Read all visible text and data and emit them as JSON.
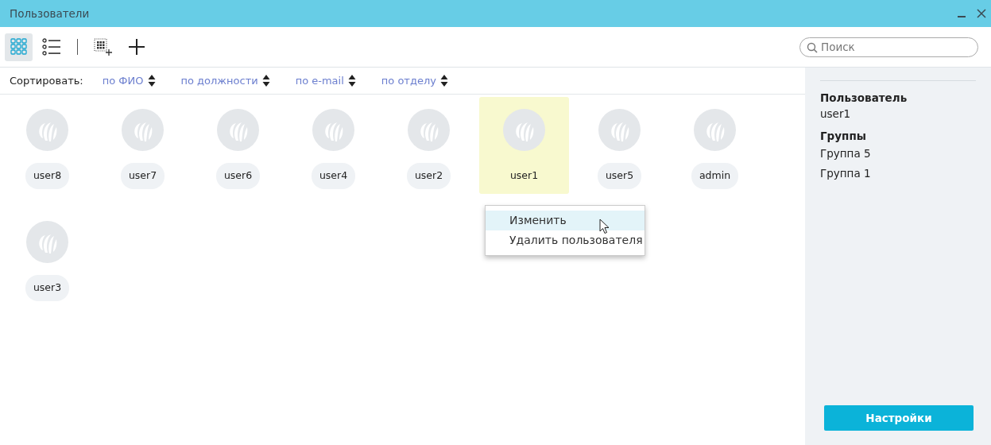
{
  "window": {
    "title": "Пользователи"
  },
  "toolbar": [
    {
      "kind": "grid-view",
      "selected": true
    },
    {
      "kind": "list-view",
      "selected": false
    },
    {
      "kind": "select-all"
    },
    {
      "kind": "add"
    }
  ],
  "search": {
    "placeholder": "Поиск"
  },
  "sort": {
    "label": "Сортировать:",
    "options": [
      {
        "label": "по ФИО"
      },
      {
        "label": "по должности"
      },
      {
        "label": "по e-mail"
      },
      {
        "label": "по отделу"
      }
    ]
  },
  "users": [
    {
      "name": "user8",
      "selected": false
    },
    {
      "name": "user7",
      "selected": false
    },
    {
      "name": "user6",
      "selected": false
    },
    {
      "name": "user4",
      "selected": false
    },
    {
      "name": "user2",
      "selected": false
    },
    {
      "name": "user1",
      "selected": true
    },
    {
      "name": "user5",
      "selected": false
    },
    {
      "name": "admin",
      "selected": false
    },
    {
      "name": "user3",
      "selected": false
    }
  ],
  "context_menu": {
    "items": [
      {
        "label": "Изменить",
        "highlighted": true
      },
      {
        "label": "Удалить пользователя",
        "highlighted": false
      }
    ]
  },
  "details": {
    "user_heading": "Пользователь",
    "user": "user1",
    "groups_heading": "Группы",
    "groups": [
      "Группа 5",
      "Группа 1"
    ]
  },
  "settings_button": "Настройки"
}
